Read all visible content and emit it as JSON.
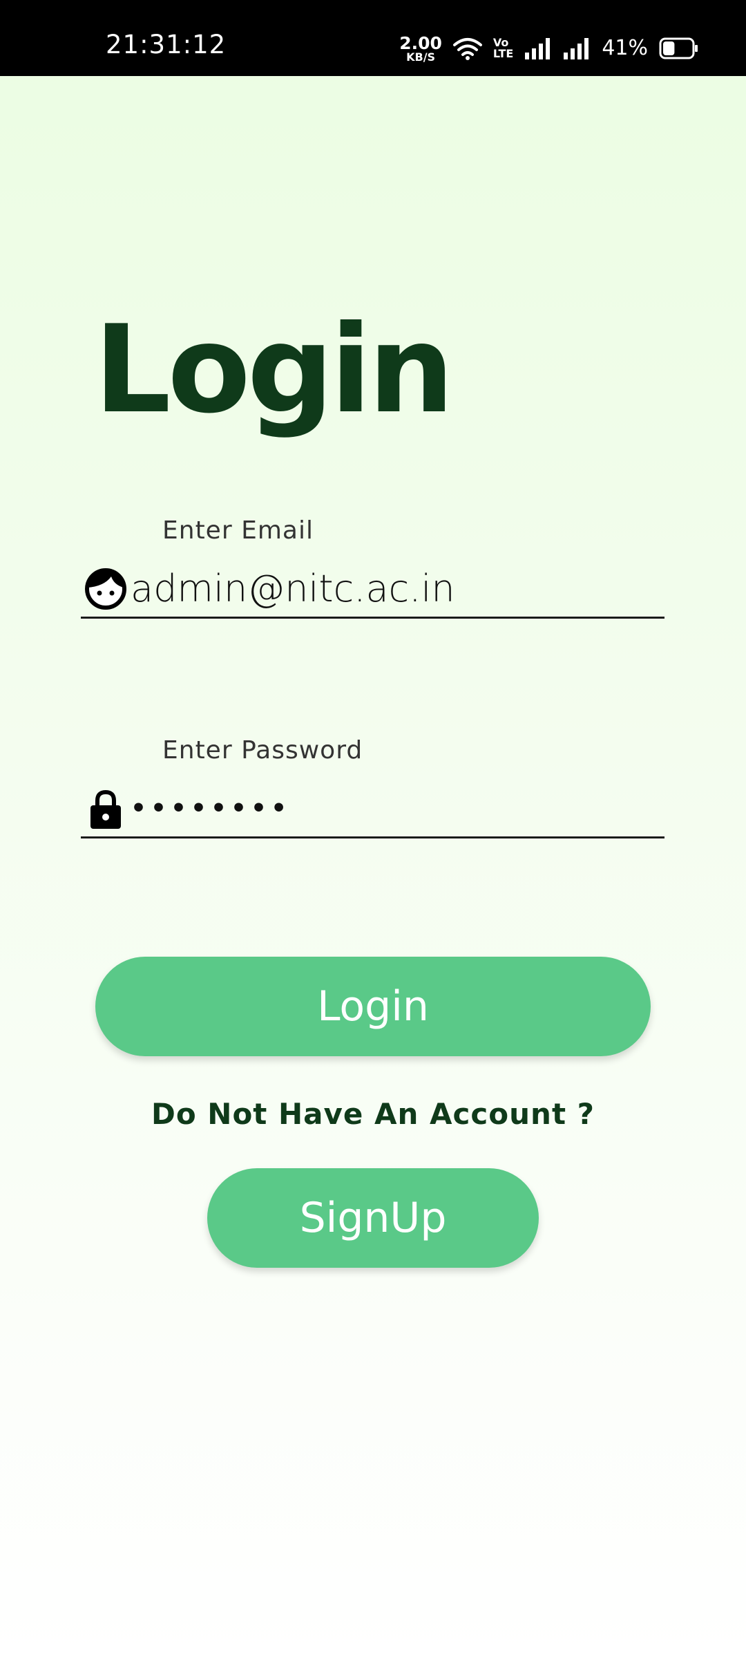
{
  "status_bar": {
    "time": "21:31:12",
    "net_speed_value": "2.00",
    "net_speed_unit": "KB/S",
    "volte_top": "Vo",
    "volte_bottom": "LTE",
    "battery_percent": "41%",
    "battery_level": 0.41
  },
  "page": {
    "title": "Login"
  },
  "email_field": {
    "label": "Enter Email",
    "value": "admin@nitc.ac.in",
    "icon": "face-icon"
  },
  "password_field": {
    "label": "Enter Password",
    "value": "••••••••",
    "icon": "lock-icon"
  },
  "actions": {
    "login_label": "Login",
    "no_account_text": "Do Not Have An Account ?",
    "signup_label": "SignUp"
  },
  "colors": {
    "title": "#0f3a1a",
    "button": "#5ac988",
    "background_top": "#ebfde2",
    "background_bottom": "#ffffff"
  }
}
